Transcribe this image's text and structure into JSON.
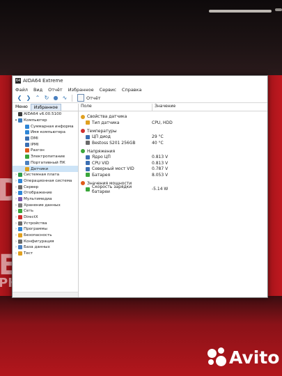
{
  "window": {
    "title": "AIDA64 Extreme",
    "icon": "aida-icon"
  },
  "menu": [
    "Файл",
    "Вид",
    "Отчёт",
    "Избранное",
    "Сервис",
    "Справка"
  ],
  "toolbar": {
    "report_label": "Отчёт"
  },
  "left_tabs": [
    "Меню",
    "Избранное"
  ],
  "tree": [
    {
      "label": "AIDA64 v6.00.5100",
      "icon": "aida-icon",
      "color": "#3a3a3a",
      "indent": 0,
      "expander": ""
    },
    {
      "label": "Компьютер",
      "icon": "computer-icon",
      "color": "#3c7fc0",
      "indent": 0,
      "expander": "v"
    },
    {
      "label": "Суммарная информа",
      "icon": "summary-icon",
      "color": "#2f86d6",
      "indent": 1,
      "expander": ""
    },
    {
      "label": "Имя компьютера",
      "icon": "computer-name-icon",
      "color": "#2f86d6",
      "indent": 1,
      "expander": ""
    },
    {
      "label": "DMI",
      "icon": "dmi-icon",
      "color": "#3b6fb3",
      "indent": 1,
      "expander": ""
    },
    {
      "label": "IPMI",
      "icon": "ipmi-icon",
      "color": "#3b6fb3",
      "indent": 1,
      "expander": ""
    },
    {
      "label": "Разгон",
      "icon": "overclock-icon",
      "color": "#e05a1a",
      "indent": 1,
      "expander": ""
    },
    {
      "label": "Электропитание",
      "icon": "power-icon",
      "color": "#3aa63a",
      "indent": 1,
      "expander": ""
    },
    {
      "label": "Портативный ПК",
      "icon": "laptop-icon",
      "color": "#4a80c0",
      "indent": 1,
      "expander": ""
    },
    {
      "label": "Датчики",
      "icon": "sensor-icon",
      "color": "#e0a020",
      "indent": 1,
      "expander": "",
      "selected": true
    },
    {
      "label": "Системная плата",
      "icon": "motherboard-icon",
      "color": "#2f9a4a",
      "indent": 0,
      "expander": ">"
    },
    {
      "label": "Операционная система",
      "icon": "windows-icon",
      "color": "#2f86d6",
      "indent": 0,
      "expander": ">"
    },
    {
      "label": "Сервер",
      "icon": "server-icon",
      "color": "#6a6a6a",
      "indent": 0,
      "expander": ">"
    },
    {
      "label": "Отображение",
      "icon": "display-icon",
      "color": "#2f86d6",
      "indent": 0,
      "expander": ">"
    },
    {
      "label": "Мультимедиа",
      "icon": "multimedia-icon",
      "color": "#7a5ab0",
      "indent": 0,
      "expander": ">"
    },
    {
      "label": "Хранение данных",
      "icon": "storage-icon",
      "color": "#7a7a7a",
      "indent": 0,
      "expander": ">"
    },
    {
      "label": "Сеть",
      "icon": "network-icon",
      "color": "#3aa63a",
      "indent": 0,
      "expander": ">"
    },
    {
      "label": "DirectX",
      "icon": "directx-icon",
      "color": "#d03030",
      "indent": 0,
      "expander": ">"
    },
    {
      "label": "Устройства",
      "icon": "devices-icon",
      "color": "#6a6a6a",
      "indent": 0,
      "expander": ">"
    },
    {
      "label": "Программы",
      "icon": "programs-icon",
      "color": "#2f86d6",
      "indent": 0,
      "expander": ">"
    },
    {
      "label": "Безопасность",
      "icon": "security-icon",
      "color": "#e0a020",
      "indent": 0,
      "expander": ">"
    },
    {
      "label": "Конфигурация",
      "icon": "config-icon",
      "color": "#6a6a6a",
      "indent": 0,
      "expander": ">"
    },
    {
      "label": "База данных",
      "icon": "database-icon",
      "color": "#4a80c0",
      "indent": 0,
      "expander": ">"
    },
    {
      "label": "Тест",
      "icon": "benchmark-icon",
      "color": "#e0a020",
      "indent": 0,
      "expander": ">"
    }
  ],
  "columns": {
    "field": "Поле",
    "value": "Значение"
  },
  "groups": [
    {
      "title": "Свойства датчика",
      "icon": "sensor-props-icon",
      "color": "#e0a020",
      "rows": [
        {
          "field": "Тип датчика",
          "value": "CPU, HDD",
          "icon": "sensor-type-icon",
          "color": "#e0a020"
        }
      ]
    },
    {
      "title": "Температуры",
      "icon": "temperature-icon",
      "color": "#d03030",
      "rows": [
        {
          "field": "ЦП диод",
          "value": "29 °C",
          "icon": "cpu-icon",
          "color": "#3b6fb3"
        },
        {
          "field": "Bestoss S201 256GB",
          "value": "40 °C",
          "icon": "disk-icon",
          "color": "#6a6a6a"
        }
      ]
    },
    {
      "title": "Напряжения",
      "icon": "voltage-icon",
      "color": "#3aa63a",
      "rows": [
        {
          "field": "Ядро ЦП",
          "value": "0.813 V",
          "icon": "cpu-icon",
          "color": "#3b6fb3"
        },
        {
          "field": "CPU VID",
          "value": "0.813 V",
          "icon": "cpu-icon",
          "color": "#3b6fb3"
        },
        {
          "field": "Северный мост VID",
          "value": "0.787 V",
          "icon": "chipset-icon",
          "color": "#3b6fb3"
        },
        {
          "field": "Батарея",
          "value": "8.053 V",
          "icon": "battery-icon",
          "color": "#3aa63a"
        }
      ]
    },
    {
      "title": "Значения мощности",
      "icon": "power-value-icon",
      "color": "#e05a1a",
      "rows": [
        {
          "field": "Скорость зарядки батареи",
          "value": "-5.14 W",
          "icon": "battery-charge-icon",
          "color": "#3aa63a"
        }
      ]
    }
  ],
  "watermark": {
    "brand": "Avito"
  }
}
